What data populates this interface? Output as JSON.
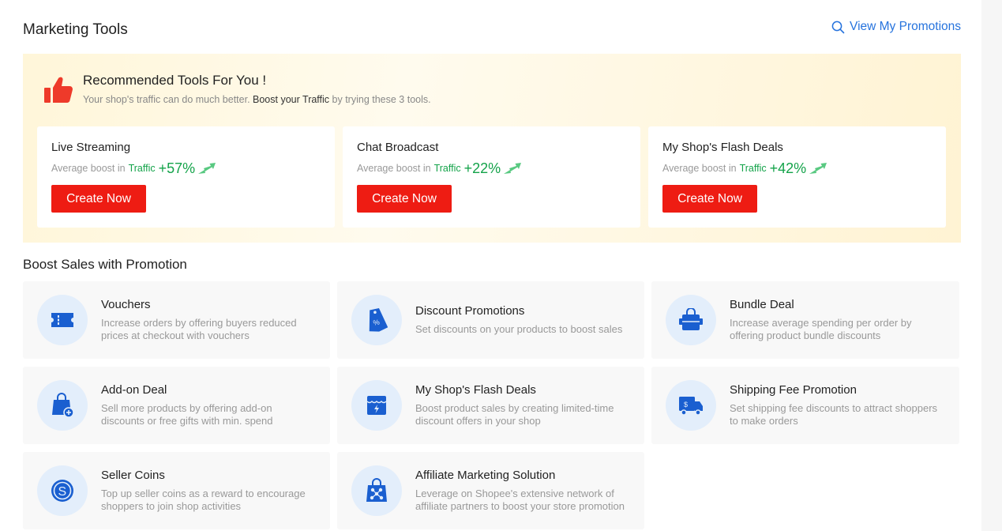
{
  "header": {
    "title": "Marketing Tools",
    "view_link": "View My Promotions"
  },
  "recommended": {
    "title": "Recommended Tools For You !",
    "subtitle_pre": "Your shop's traffic can do much better. ",
    "subtitle_bold": "Boost your Traffic",
    "subtitle_post": " by trying these 3 tools.",
    "boost_label": "Average boost in",
    "traffic_label": "Traffic",
    "cta_label": "Create Now",
    "tools": [
      {
        "name": "Live Streaming",
        "boost": "+57%"
      },
      {
        "name": "Chat Broadcast",
        "boost": "+22%"
      },
      {
        "name": "My Shop's Flash Deals",
        "boost": "+42%"
      }
    ]
  },
  "promotions": {
    "title": "Boost Sales with Promotion",
    "items": [
      {
        "name": "Vouchers",
        "desc": "Increase orders by offering buyers reduced prices at checkout with vouchers",
        "icon": "voucher-icon"
      },
      {
        "name": "Discount Promotions",
        "desc": "Set discounts on your products to boost sales",
        "icon": "discount-tag-icon"
      },
      {
        "name": "Bundle Deal",
        "desc": "Increase average spending per order by offering product bundle discounts",
        "icon": "bundle-bag-icon"
      },
      {
        "name": "Add-on Deal",
        "desc": "Sell more products by offering add-on discounts or free gifts with min. spend",
        "icon": "add-on-bag-icon"
      },
      {
        "name": "My Shop's Flash Deals",
        "desc": "Boost product sales by creating limited-time discount offers in your shop",
        "icon": "flash-shop-icon"
      },
      {
        "name": "Shipping Fee Promotion",
        "desc": "Set shipping fee discounts to attract shoppers to make orders",
        "icon": "shipping-truck-icon"
      },
      {
        "name": "Seller Coins",
        "desc": "Top up seller coins as a reward to encourage shoppers to join shop activities",
        "icon": "coin-icon"
      },
      {
        "name": "Affiliate Marketing Solution",
        "desc": "Leverage on Shopee's extensive network of affiliate partners to boost your store promotion",
        "icon": "affiliate-bag-icon"
      }
    ]
  },
  "colors": {
    "accent_blue": "#2673dd",
    "cta_red": "#ee1c13",
    "boost_green": "#14a34a"
  }
}
